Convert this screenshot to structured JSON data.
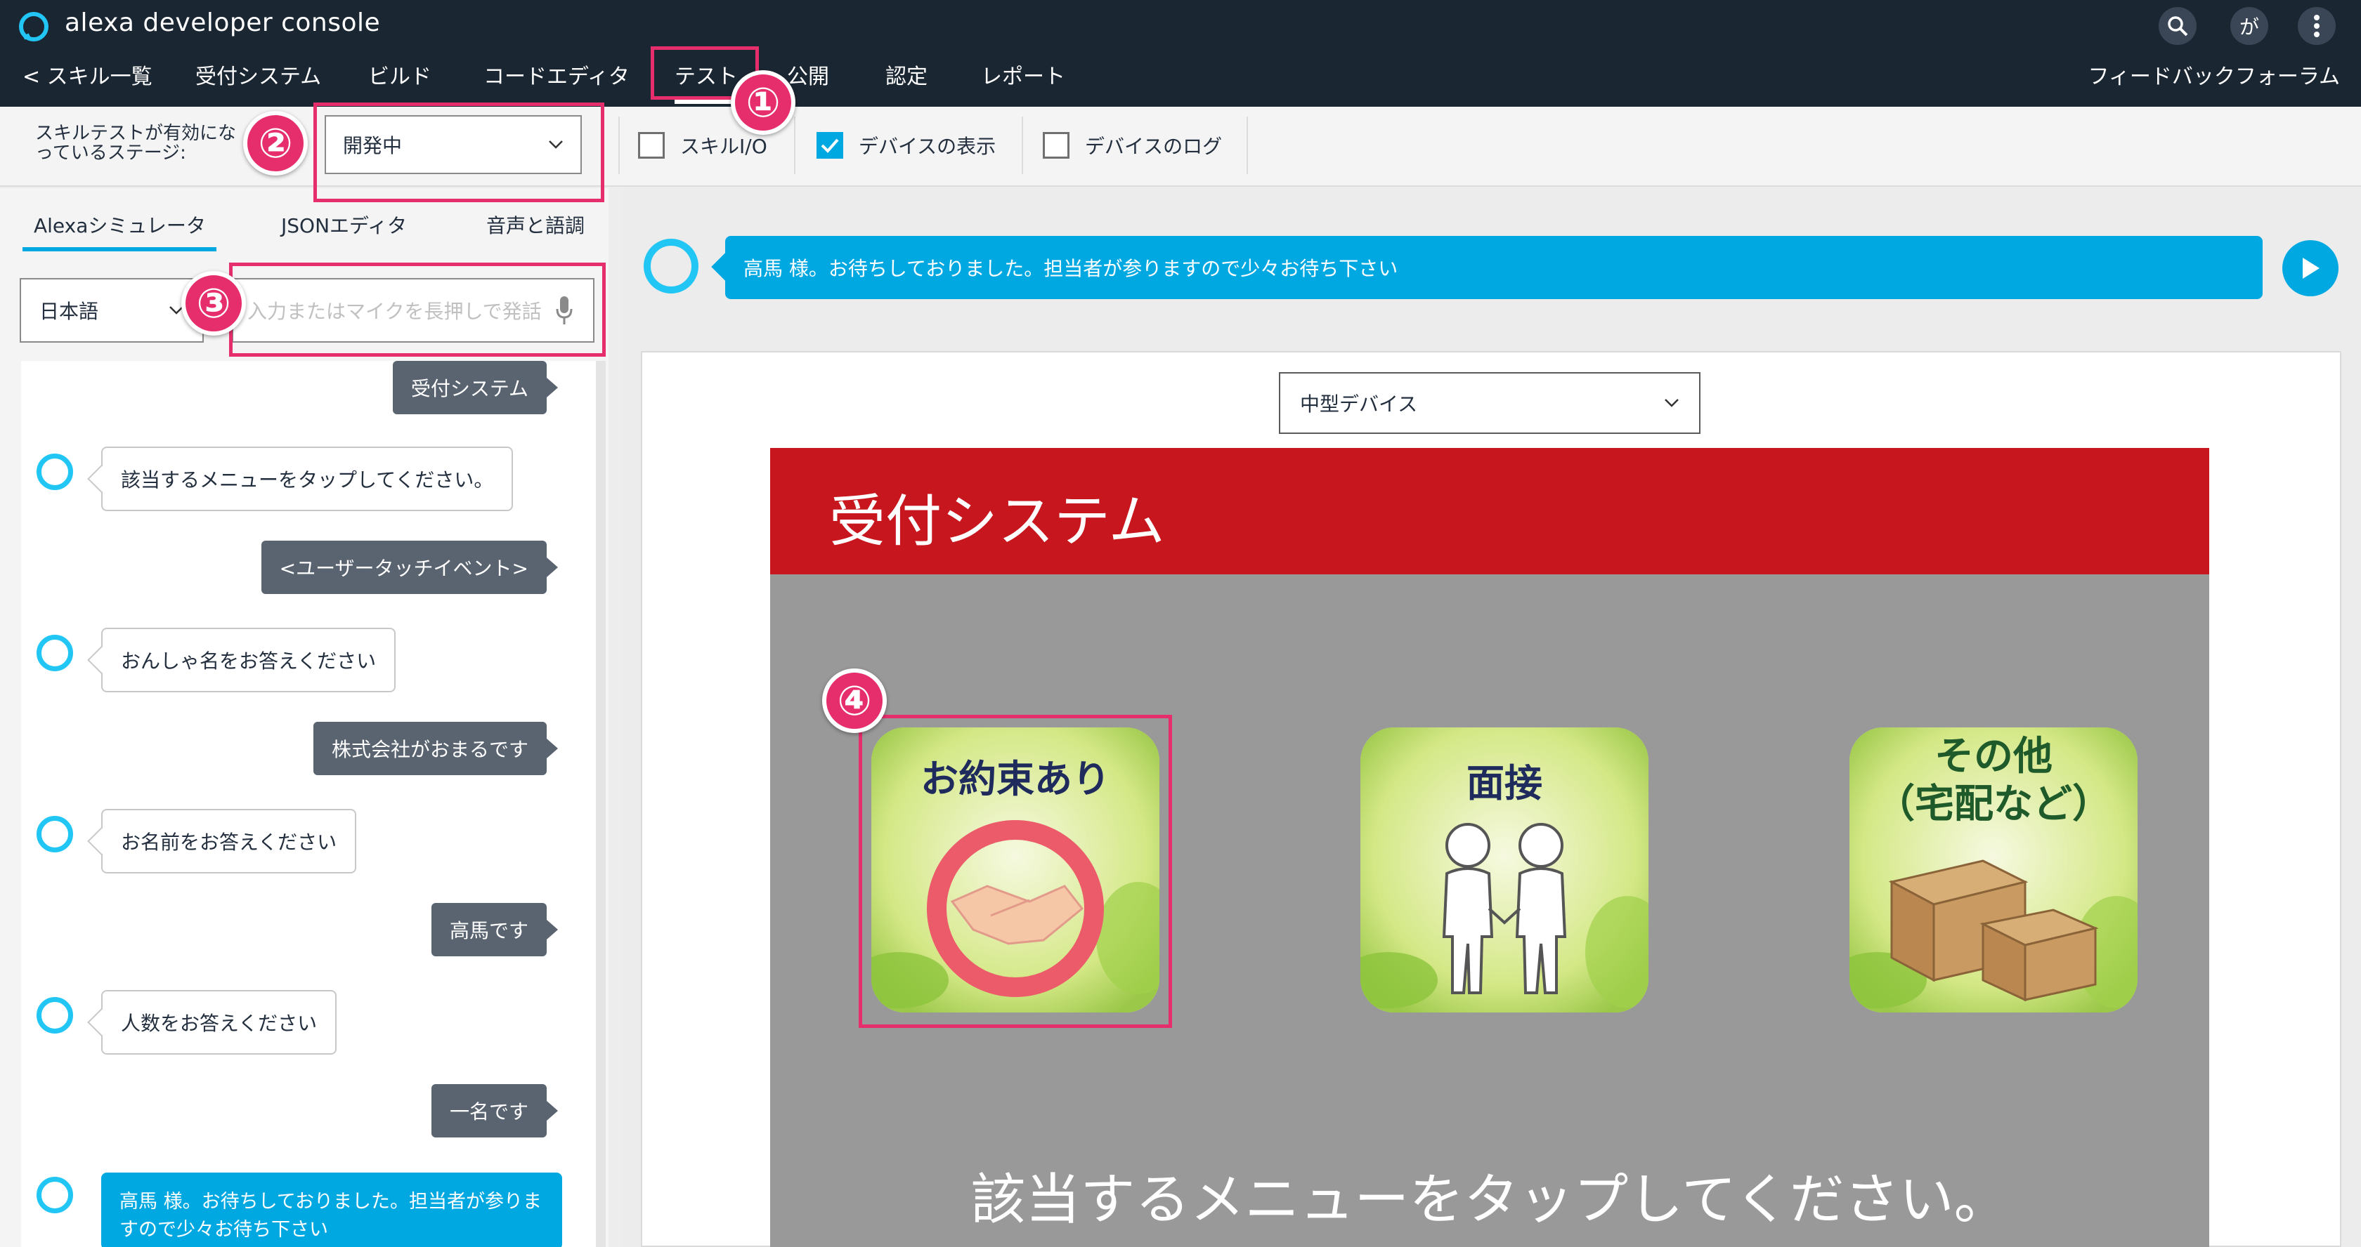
{
  "header": {
    "app_title": "alexa developer console",
    "logo_icon": "alexa-ring-icon",
    "user_initial": "が",
    "feedback_link": "フィードバックフォーラム",
    "nav": [
      {
        "label": "< スキル一覧"
      },
      {
        "label": "受付システム"
      },
      {
        "label": "ビルド"
      },
      {
        "label": "コードエディタ"
      },
      {
        "label": "テスト",
        "active": true
      },
      {
        "label": "公開"
      },
      {
        "label": "認定"
      },
      {
        "label": "レポート"
      }
    ]
  },
  "stage_bar": {
    "label": "スキルテストが有効になっているステージ:",
    "stage_value": "開発中",
    "checkboxes": [
      {
        "label": "スキルI/O",
        "checked": false
      },
      {
        "label": "デバイスの表示",
        "checked": true
      },
      {
        "label": "デバイスのログ",
        "checked": false
      }
    ]
  },
  "left_panel": {
    "tabs": [
      {
        "label": "Alexaシミュレータ",
        "active": true
      },
      {
        "label": "JSONエディタ"
      },
      {
        "label": "音声と語調"
      }
    ],
    "language": "日本語",
    "input_placeholder": "入力またはマイクを長押しで発話",
    "chat": [
      {
        "from": "user",
        "text": "受付システム"
      },
      {
        "from": "alexa",
        "text": "該当するメニューをタップしてください。"
      },
      {
        "from": "user",
        "text": "<ユーザータッチイベント>"
      },
      {
        "from": "alexa",
        "text": "おんしゃ名をお答えください"
      },
      {
        "from": "user",
        "text": "株式会社がおまるです"
      },
      {
        "from": "alexa",
        "text": "お名前をお答えください"
      },
      {
        "from": "user",
        "text": "高馬です"
      },
      {
        "from": "alexa",
        "text": "人数をお答えください"
      },
      {
        "from": "user",
        "text": "一名です"
      },
      {
        "from": "alexa",
        "text": "高馬 様。お待ちしておりました。担当者が参りますので少々お待ち下さい",
        "highlight": true
      }
    ]
  },
  "right_panel": {
    "response_text": "高馬 様。お待ちしておりました。担当者が参りますので少々お待ち下さい",
    "device_select": "中型デバイス",
    "apl": {
      "title": "受付システム",
      "tiles": [
        {
          "label": "お約束あり",
          "icon": "handshake-icon"
        },
        {
          "label": "面接",
          "icon": "interview-icon"
        },
        {
          "label": "その他",
          "label2": "（宅配など）",
          "icon": "boxes-icon"
        }
      ],
      "prompt": "該当するメニューをタップしてください。"
    }
  },
  "callouts": [
    "①",
    "②",
    "③",
    "④"
  ],
  "colors": {
    "header_bg": "#1b2633",
    "accent_blue": "#00a8e1",
    "apl_red": "#c8161e",
    "callout_pink": "#e62e6c"
  }
}
